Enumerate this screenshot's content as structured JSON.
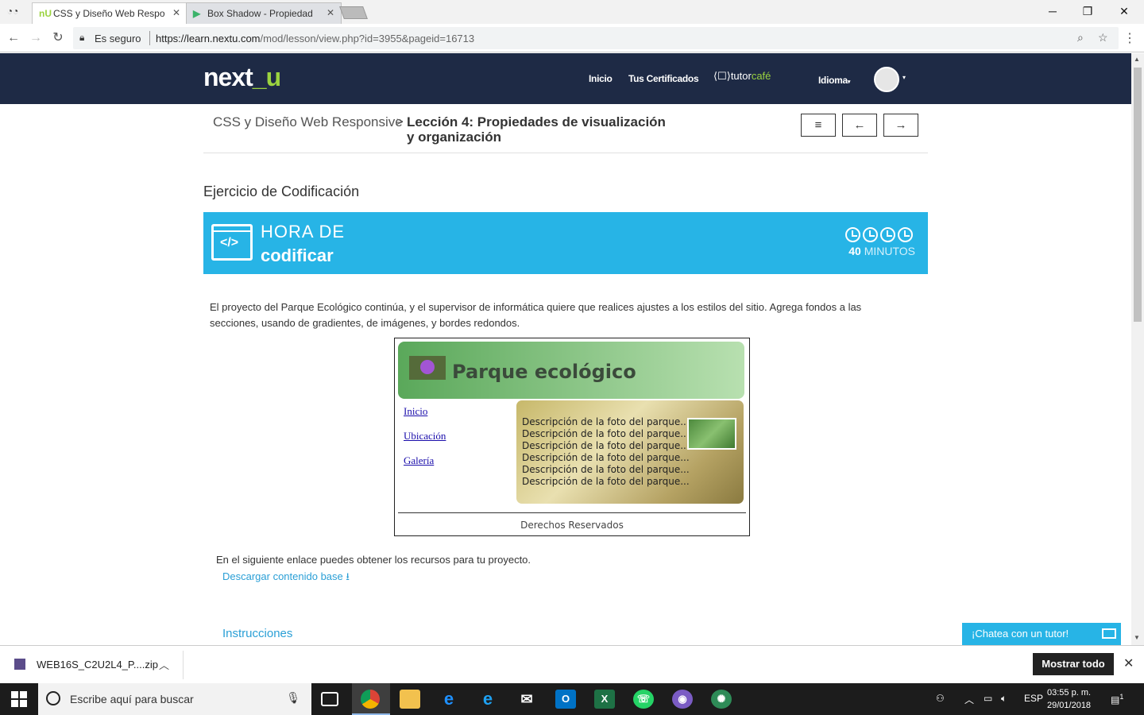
{
  "browser": {
    "tabs": [
      {
        "title": "CSS y Diseño Web Respo",
        "favicon": "nU",
        "active": true
      },
      {
        "title": "Box Shadow - Propiedad",
        "favicon": "play",
        "active": false
      }
    ],
    "secure_label": "Es seguro",
    "url_host": "https://learn.nextu.com",
    "url_path": "/mod/lesson/view.php?id=3955&pageid=16713"
  },
  "site": {
    "logo_main": "next",
    "logo_accent": "_u",
    "nav": [
      "Inicio",
      "Tus Certificados"
    ],
    "tutorcafe_a": "tutor",
    "tutorcafe_b": "café",
    "language": "Idioma",
    "colors": {
      "header": "#1e2a45",
      "accent": "#9bd33f",
      "banner": "#27b4e6",
      "link": "#2a9fd6"
    }
  },
  "breadcrumb": {
    "course": "CSS y Diseño Web Responsive",
    "separator": ">",
    "lesson": "Lección 4: Propiedades de visualización y organización"
  },
  "lesson_nav": {
    "menu": "≡",
    "prev": "←",
    "next": "→"
  },
  "exercise": {
    "title": "Ejercicio de Codificación",
    "banner_line1": "HORA DE",
    "banner_line2": "codificar",
    "minutes_value": "40",
    "minutes_label": "MINUTOS",
    "intro": "El proyecto del Parque Ecológico continúa, y el supervisor de informática quiere que realices ajustes a los estilos del sitio. Agrega fondos a las secciones, usando de gradientes, de imágenes, y bordes redondos."
  },
  "preview": {
    "title": "Parque ecológico",
    "links": [
      "Inicio",
      "Ubicación",
      "Galería"
    ],
    "descriptions": [
      "Descripción de la foto del parque...",
      "Descripción de la foto del parque...",
      "Descripción de la foto del parque...",
      "Descripción de la foto del parque...",
      "Descripción de la foto del parque...",
      "Descripción de la foto del parque..."
    ],
    "footer": "Derechos Reservados"
  },
  "resources": {
    "text": "En el siguiente enlace puedes obtener los recursos para tu proyecto.",
    "link": "Descargar contenido base",
    "instructions": "Instrucciones"
  },
  "chat": {
    "label": "¡Chatea con un tutor!"
  },
  "downloads": {
    "file": "WEB16S_C2U2L4_P....zip",
    "show_all": "Mostrar todo"
  },
  "taskbar": {
    "search_placeholder": "Escribe aquí para buscar",
    "lang": "ESP",
    "time": "03:55 p. m.",
    "date": "29/01/2018",
    "notifications": "1"
  }
}
